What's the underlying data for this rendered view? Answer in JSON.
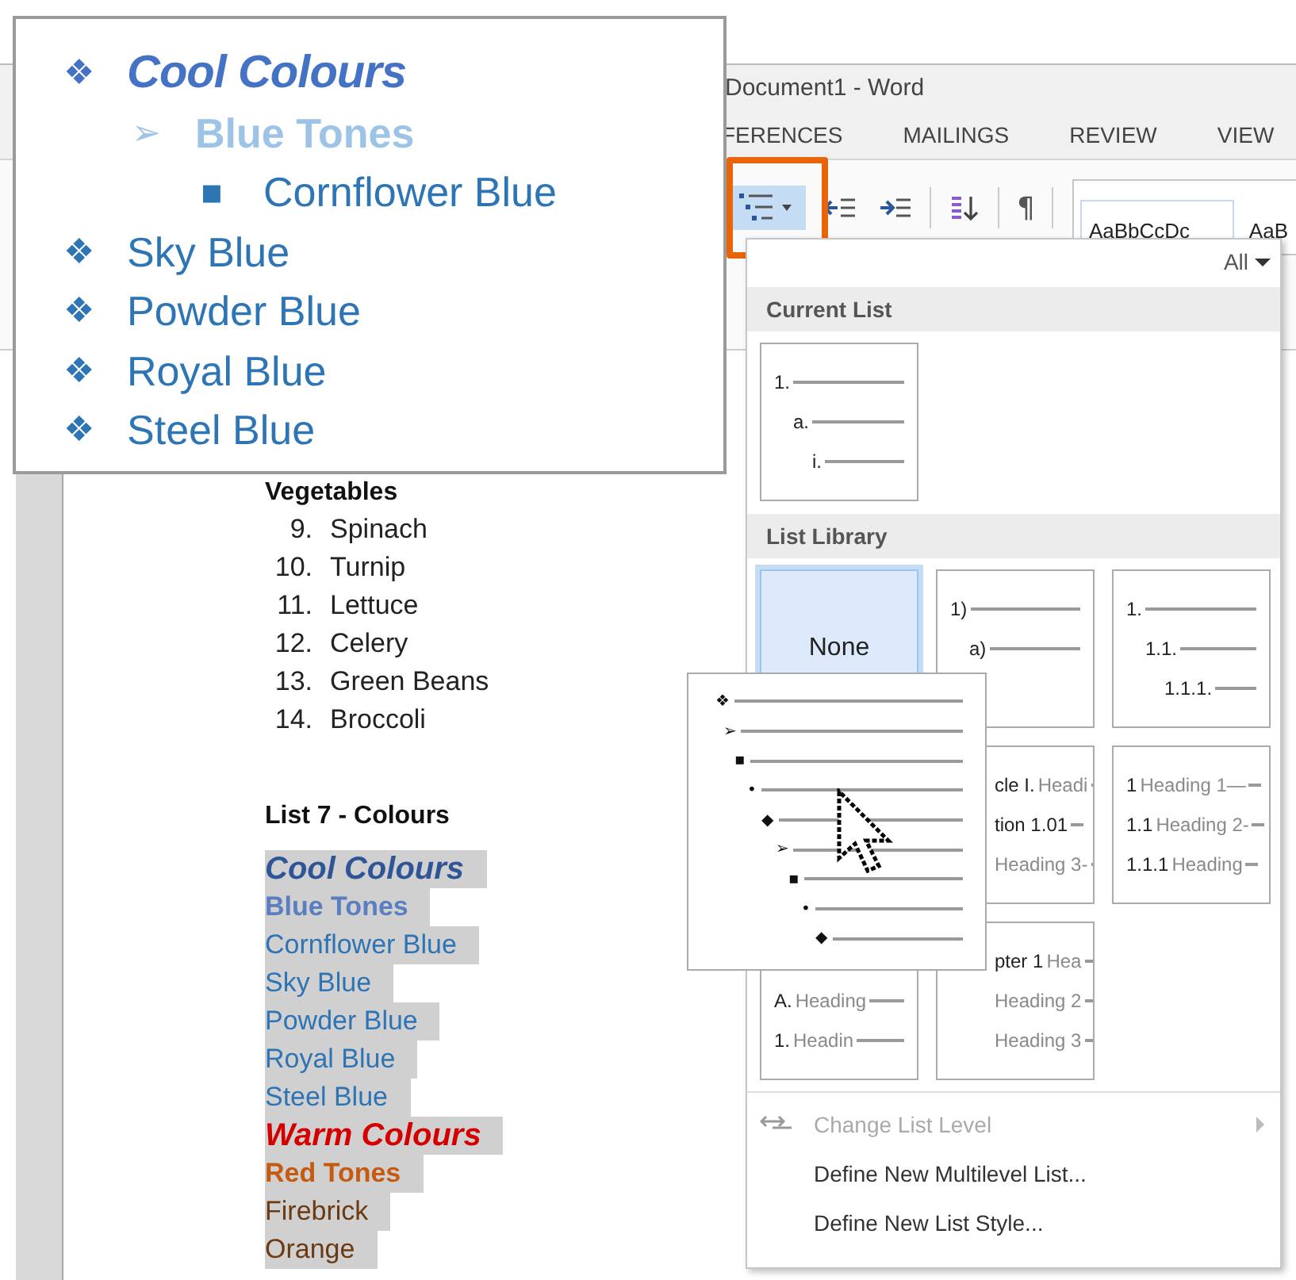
{
  "title_bar": {
    "title": "Document1 - Word"
  },
  "ribbon_tabs": [
    {
      "label": "FERENCES"
    },
    {
      "label": "MAILINGS"
    },
    {
      "label": "REVIEW"
    },
    {
      "label": "VIEW"
    }
  ],
  "ribbon": {
    "multilevel_selected": true,
    "pilcrow": "¶",
    "styles": [
      "AaBbCcDc",
      "AaB"
    ]
  },
  "document": {
    "vegetables_heading": "Vegetables",
    "numbered_list": [
      {
        "num": "9.",
        "text": "Spinach"
      },
      {
        "num": "10.",
        "text": "Turnip"
      },
      {
        "num": "11.",
        "text": "Lettuce"
      },
      {
        "num": "12.",
        "text": "Celery"
      },
      {
        "num": "13.",
        "text": "Green Beans"
      },
      {
        "num": "14.",
        "text": "Broccoli"
      }
    ],
    "colours_heading": "List 7 - Colours",
    "colour_list": [
      {
        "text": "Cool Colours",
        "kind": "heading1",
        "color": "#2f5597"
      },
      {
        "text": "Blue Tones",
        "kind": "heading2",
        "color": "#5a7fc0"
      },
      {
        "text": "Cornflower Blue",
        "kind": "item",
        "color": "#2e74b5"
      },
      {
        "text": "Sky Blue",
        "kind": "item",
        "color": "#2e74b5"
      },
      {
        "text": "Powder Blue",
        "kind": "item",
        "color": "#2e74b5"
      },
      {
        "text": "Royal Blue",
        "kind": "item",
        "color": "#2e74b5"
      },
      {
        "text": "Steel Blue",
        "kind": "item",
        "color": "#2e74b5"
      },
      {
        "text": "Warm Colours",
        "kind": "heading1",
        "color": "#d40000"
      },
      {
        "text": "Red Tones",
        "kind": "heading2",
        "color": "#c55a11"
      },
      {
        "text": "Firebrick",
        "kind": "item",
        "color": "#6b3a12"
      },
      {
        "text": "Orange",
        "kind": "item",
        "color": "#6b3a12"
      }
    ]
  },
  "multilevel_menu": {
    "filter": "All",
    "sections": [
      {
        "title": "Current List",
        "rows": [
          [
            {
              "kind": "indented",
              "selected": false,
              "lines": [
                {
                  "num": "1."
                },
                {
                  "num": "a."
                },
                {
                  "num": "i."
                }
              ]
            }
          ]
        ]
      },
      {
        "title": "List Library",
        "rows": [
          [
            {
              "kind": "none",
              "selected": true,
              "label": "None"
            },
            {
              "kind": "indented",
              "selected": false,
              "lines": [
                {
                  "num": "1)"
                },
                {
                  "num": "a)"
                }
              ]
            },
            {
              "kind": "indented",
              "selected": false,
              "lines": [
                {
                  "num": "1."
                },
                {
                  "num": "1.1."
                },
                {
                  "num": "1.1.1."
                }
              ]
            }
          ],
          [
            "",
            {
              "kind": "clipped_left",
              "selected": false,
              "lines": [
                {
                  "num": "cle I.",
                  "text": "Headi"
                },
                {
                  "num": "tion 1.01"
                },
                {
                  "text": "Heading 3-"
                }
              ]
            },
            {
              "kind": "flat",
              "selected": false,
              "lines": [
                {
                  "num": "1",
                  "text": "Heading 1—"
                },
                {
                  "num": "1.1",
                  "text": "Heading 2-"
                },
                {
                  "num": "1.1.1",
                  "text": "Heading"
                }
              ]
            }
          ],
          [
            {
              "kind": "clipped_top",
              "selected": false,
              "lines": [
                {
                  "num": "A.",
                  "text": "Heading"
                },
                {
                  "num": "1.",
                  "text": "Headin"
                }
              ]
            },
            {
              "kind": "clipped_left",
              "selected": false,
              "lines": [
                {
                  "num": "pter 1",
                  "text": "Hea"
                },
                {
                  "text": "Heading 2"
                },
                {
                  "text": "Heading 3"
                }
              ]
            }
          ]
        ]
      }
    ],
    "commands": [
      {
        "label": "Change List Level",
        "kind": "submenu",
        "disabled": true
      },
      {
        "label": "Define New Multilevel List...",
        "kind": "action",
        "disabled": false
      },
      {
        "label": "Define New List Style...",
        "kind": "action",
        "disabled": false
      }
    ]
  },
  "preview_popup": {
    "lines": [
      {
        "bullet": "❖"
      },
      {
        "bullet": "➢"
      },
      {
        "bullet": "▪"
      },
      {
        "bullet": "•"
      },
      {
        "bullet": "◆"
      },
      {
        "bullet": "➢"
      },
      {
        "bullet": "▪"
      },
      {
        "bullet": "•"
      },
      {
        "bullet": "◆"
      }
    ]
  },
  "zoom_callout": {
    "items": [
      {
        "bullet": "❖",
        "text": "Cool Colours",
        "kind": "heading1",
        "color": "#4472c4",
        "children": [
          {
            "bullet": "➢",
            "text": "Blue Tones",
            "kind": "heading2",
            "color": "#9dc3e6",
            "children": [
              {
                "bullet": "▪",
                "text": "Cornflower Blue",
                "kind": "item",
                "color": "#2e75b6"
              }
            ]
          }
        ]
      },
      {
        "bullet": "❖",
        "text": "Sky Blue",
        "kind": "item",
        "color": "#2e75b6"
      },
      {
        "bullet": "❖",
        "text": "Powder Blue",
        "kind": "item",
        "color": "#2e75b6"
      },
      {
        "bullet": "❖",
        "text": "Royal Blue",
        "kind": "item",
        "color": "#2e75b6"
      },
      {
        "bullet": "❖",
        "text": "Steel Blue",
        "kind": "item",
        "color": "#2e75b6"
      }
    ]
  }
}
